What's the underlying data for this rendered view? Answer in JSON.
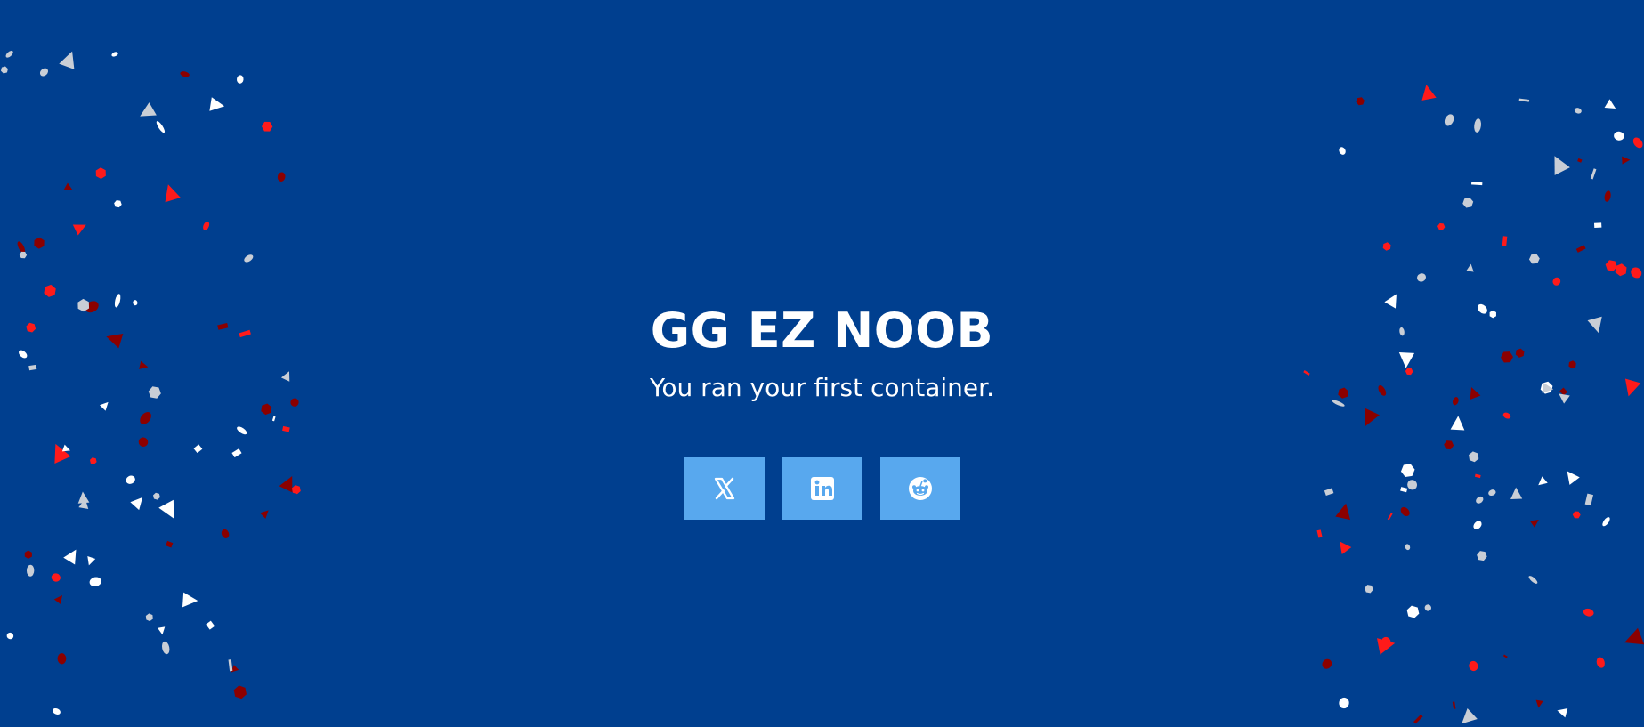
{
  "page": {
    "headline": "GG EZ NOOB",
    "subtitle": "You ran your first container.",
    "background_color": "#003f8f"
  },
  "share_buttons": [
    {
      "name": "x-twitter",
      "icon": "x-logo-icon",
      "color": "#58a8ee"
    },
    {
      "name": "linkedin",
      "icon": "linkedin-logo-icon",
      "color": "#58a8ee"
    },
    {
      "name": "reddit",
      "icon": "reddit-logo-icon",
      "color": "#58a8ee"
    }
  ],
  "confetti": {
    "colors": [
      "#ffffff",
      "#c9ced6",
      "#ff1a1a",
      "#8b0000"
    ]
  }
}
